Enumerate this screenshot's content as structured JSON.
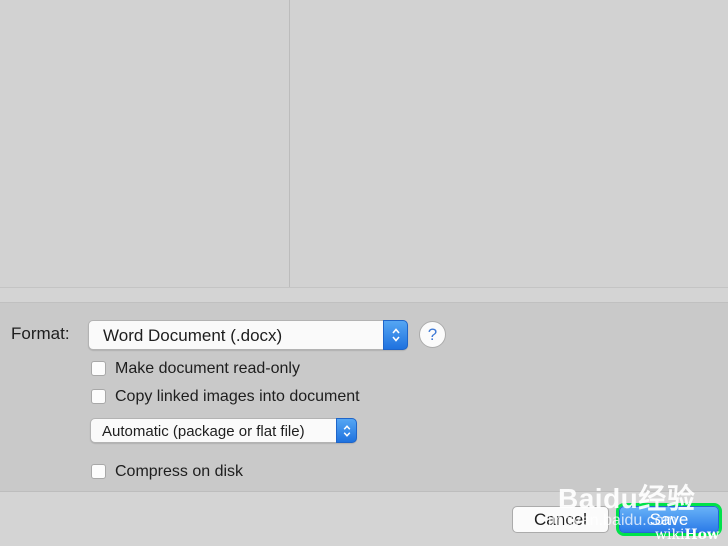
{
  "options": {
    "format_label": "Format:",
    "format_value": "Word Document (.docx)",
    "help_label": "?",
    "read_only_label": "Make document read-only",
    "copy_images_label": "Copy linked images into document",
    "image_mode_value": "Automatic (package or flat file)",
    "compress_label": "Compress on disk"
  },
  "buttons": {
    "cancel_label": "Cancel",
    "save_label": "Save"
  },
  "watermarks": {
    "baidu": "Baidu经验",
    "baidu_url": "jingyan.baidu.com",
    "wikihow_prefix": "wiki",
    "wikihow_suffix": "How"
  },
  "colors": {
    "accent": "#2a7ae8",
    "highlight": "#00e24a"
  }
}
